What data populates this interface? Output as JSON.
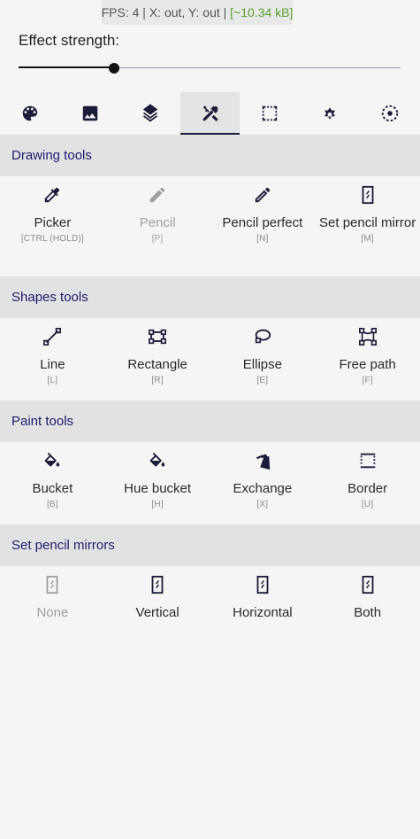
{
  "status": {
    "fps_label": "FPS: 4",
    "coords_label": "X: out, Y: out",
    "size_label": "[~10.34 kB]",
    "separator": "|"
  },
  "effect": {
    "label": "Effect strength:",
    "value_fraction": 0.25
  },
  "tabs": [
    {
      "icon": "palette-icon",
      "active": false
    },
    {
      "icon": "image-icon",
      "active": false
    },
    {
      "icon": "layers-icon",
      "active": false
    },
    {
      "icon": "tools-icon",
      "active": true
    },
    {
      "icon": "selection-icon",
      "active": false
    },
    {
      "icon": "settings-icon",
      "active": false
    },
    {
      "icon": "target-icon",
      "active": false
    }
  ],
  "sections": {
    "drawing": {
      "title": "Drawing tools",
      "tools": [
        {
          "name": "Picker",
          "key": "[CTRL (HOLD)]",
          "icon": "eyedropper-icon",
          "disabled": false
        },
        {
          "name": "Pencil",
          "key": "[P]",
          "icon": "pencil-icon",
          "disabled": true
        },
        {
          "name": "Pencil perfect",
          "key": "[N]",
          "icon": "pencil-perfect-icon",
          "disabled": false
        },
        {
          "name": "Set pencil mirror",
          "key": "[M]",
          "icon": "mirror-icon",
          "disabled": false
        }
      ]
    },
    "shapes": {
      "title": "Shapes tools",
      "tools": [
        {
          "name": "Line",
          "key": "[L]",
          "icon": "line-icon"
        },
        {
          "name": "Rectangle",
          "key": "[R]",
          "icon": "rectangle-icon"
        },
        {
          "name": "Ellipse",
          "key": "[E]",
          "icon": "ellipse-icon"
        },
        {
          "name": "Free path",
          "key": "[F]",
          "icon": "free-path-icon"
        }
      ]
    },
    "paint": {
      "title": "Paint tools",
      "tools": [
        {
          "name": "Bucket",
          "key": "[B]",
          "icon": "bucket-icon"
        },
        {
          "name": "Hue bucket",
          "key": "[H]",
          "icon": "hue-bucket-icon"
        },
        {
          "name": "Exchange",
          "key": "[X]",
          "icon": "exchange-icon"
        },
        {
          "name": "Border",
          "key": "[U]",
          "icon": "border-icon"
        }
      ]
    },
    "mirrors": {
      "title": "Set pencil mirrors",
      "options": [
        {
          "name": "None",
          "icon": "mirror-none-icon",
          "disabled": true
        },
        {
          "name": "Vertical",
          "icon": "mirror-vertical-icon",
          "disabled": false
        },
        {
          "name": "Horizontal",
          "icon": "mirror-horizontal-icon",
          "disabled": false
        },
        {
          "name": "Both",
          "icon": "mirror-both-icon",
          "disabled": false
        }
      ]
    }
  },
  "colors": {
    "accent": "#1b1b3a",
    "section_title": "#1b1b6e",
    "size_text": "#5aa02c",
    "disabled": "#9e9e9e"
  }
}
